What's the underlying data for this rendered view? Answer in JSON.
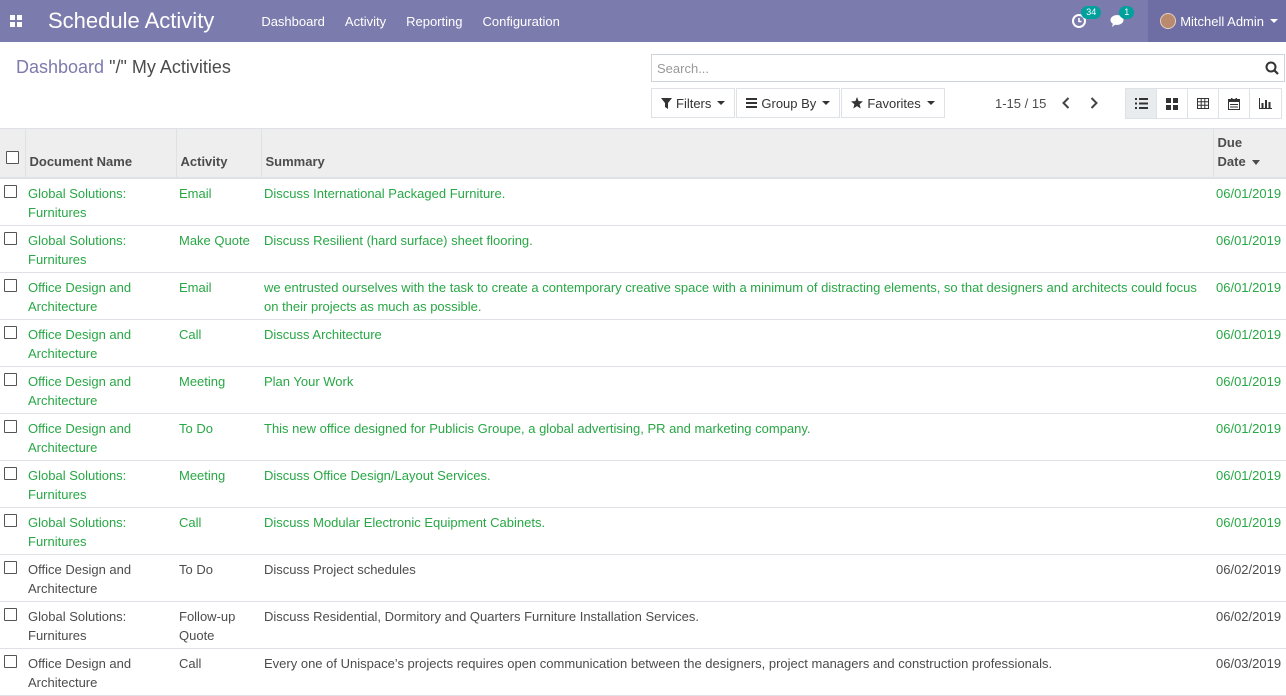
{
  "navbar": {
    "app_title": "Schedule Activity",
    "menu": [
      "Dashboard",
      "Activity",
      "Reporting",
      "Configuration"
    ],
    "activity_badge": "34",
    "message_badge": "1",
    "user_name": "Mitchell Admin",
    "color": "#7c7bad"
  },
  "breadcrumb": {
    "parent": "Dashboard",
    "separator": "\"/\"",
    "current": "My Activities"
  },
  "search": {
    "placeholder": "Search..."
  },
  "filters": {
    "filters_label": "Filters",
    "group_by_label": "Group By",
    "favorites_label": "Favorites"
  },
  "pager": {
    "text": "1-15 / 15"
  },
  "views": [
    "list-icon",
    "kanban-icon",
    "pivot-icon",
    "calendar-icon",
    "graph-icon"
  ],
  "table": {
    "columns": {
      "document_name": "Document Name",
      "activity": "Activity",
      "summary": "Summary",
      "due_date_line1": "Due",
      "due_date_line2": "Date"
    },
    "rows": [
      {
        "doc1": "Global Solutions:",
        "doc2": "Furnitures",
        "activity": "Email",
        "summary": "Discuss International Packaged Furniture.",
        "due": "06/01/2019",
        "status": "today"
      },
      {
        "doc1": "Global Solutions:",
        "doc2": "Furnitures",
        "activity": "Make Quote",
        "summary": "Discuss Resilient (hard surface) sheet flooring.",
        "due": "06/01/2019",
        "status": "today"
      },
      {
        "doc1": "Office Design and",
        "doc2": "Architecture",
        "activity": "Email",
        "summary": "we entrusted ourselves with the task to create a contemporary creative space with a minimum of distracting elements, so that designers and architects could focus on their projects as much as possible.",
        "due": "06/01/2019",
        "status": "today"
      },
      {
        "doc1": "Office Design and",
        "doc2": "Architecture",
        "activity": "Call",
        "summary": "Discuss Architecture",
        "due": "06/01/2019",
        "status": "today"
      },
      {
        "doc1": "Office Design and",
        "doc2": "Architecture",
        "activity": "Meeting",
        "summary": "Plan Your Work",
        "due": "06/01/2019",
        "status": "today"
      },
      {
        "doc1": "Office Design and",
        "doc2": "Architecture",
        "activity": "To Do",
        "summary": "This new office designed for Publicis Groupe, a global advertising, PR and marketing company.",
        "due": "06/01/2019",
        "status": "today"
      },
      {
        "doc1": "Global Solutions:",
        "doc2": "Furnitures",
        "activity": "Meeting",
        "summary": "Discuss Office Design/Layout Services.",
        "due": "06/01/2019",
        "status": "today"
      },
      {
        "doc1": "Global Solutions:",
        "doc2": "Furnitures",
        "activity": "Call",
        "summary": "Discuss Modular Electronic Equipment Cabinets.",
        "due": "06/01/2019",
        "status": "today"
      },
      {
        "doc1": "Office Design and",
        "doc2": "Architecture",
        "activity": "To Do",
        "summary": "Discuss Project schedules",
        "due": "06/02/2019",
        "status": "planned"
      },
      {
        "doc1": "Global Solutions:",
        "doc2": "Furnitures",
        "activity": "Follow-up Quote",
        "summary": "Discuss Residential, Dormitory and Quarters Furniture Installation Services.",
        "due": "06/02/2019",
        "status": "planned"
      },
      {
        "doc1": "Office Design and",
        "doc2": "Architecture",
        "activity": "Call",
        "summary": "Every one of Unispace’s projects requires open communication between the designers, project managers and construction professionals.",
        "due": "06/03/2019",
        "status": "planned"
      }
    ]
  },
  "colors": {
    "due_today": "#28a745",
    "planned": "#4c4c4c",
    "brand": "#7c7bad"
  }
}
